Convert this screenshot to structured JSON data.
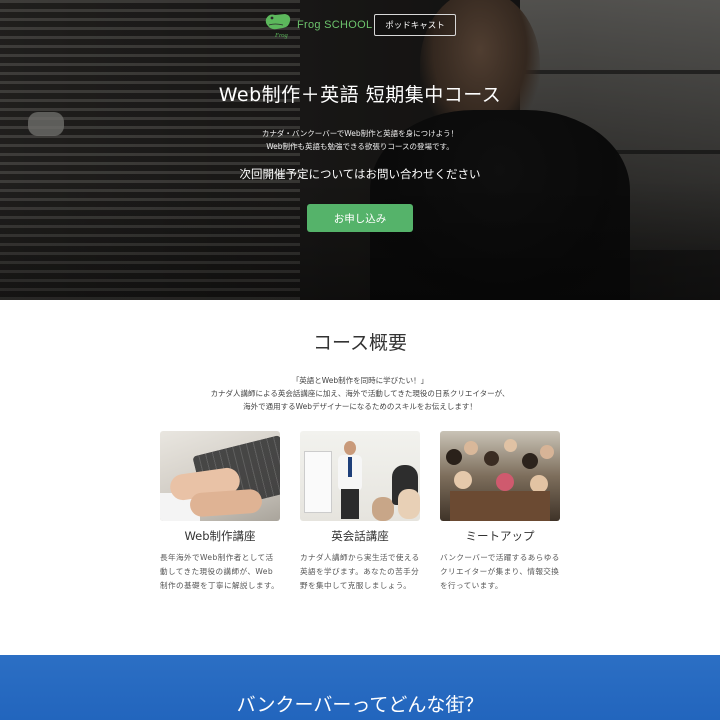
{
  "header": {
    "logo_text": "Frog SCHOOL",
    "logo_mark_text": "Frog",
    "podcast_button": "ポッドキャスト"
  },
  "hero": {
    "title": "Web制作＋英語 短期集中コース",
    "subtitle_lines": [
      "カナダ・バンクーバーでWeb制作と英語を身につけよう！",
      "Web制作も英語も勉強できる欲張りコースの登場です。"
    ],
    "notice": "次回開催予定についてはお問い合わせください",
    "apply_button": "お申し込み"
  },
  "overview": {
    "title": "コース概要",
    "intro_lines": [
      "「英語とWeb制作を同時に学びたい！」",
      "カナダ人講師による英会話講座に加え、海外で活動してきた現役の日系クリエイターが、",
      "海外で通用するWebデザイナーになるためのスキルをお伝えします！"
    ],
    "cards": [
      {
        "title": "Web制作講座",
        "text": "長年海外でWeb制作者として活動してきた現役の講師が、Web制作の基礎を丁寧に解説します。"
      },
      {
        "title": "英会話講座",
        "text": "カナダ人講師から実生活で使える英語を学びます。あなたの苦手分野を集中して克服しましょう。"
      },
      {
        "title": "ミートアップ",
        "text": "バンクーバーで活躍するあらゆるクリエイターが集まり、情報交換を行っています。"
      }
    ]
  },
  "vancouver": {
    "title": "バンクーバーってどんな街？"
  },
  "colors": {
    "accent_green": "#55b36a",
    "logo_green": "#6cc36c",
    "section_blue": "#2c6fc4"
  }
}
